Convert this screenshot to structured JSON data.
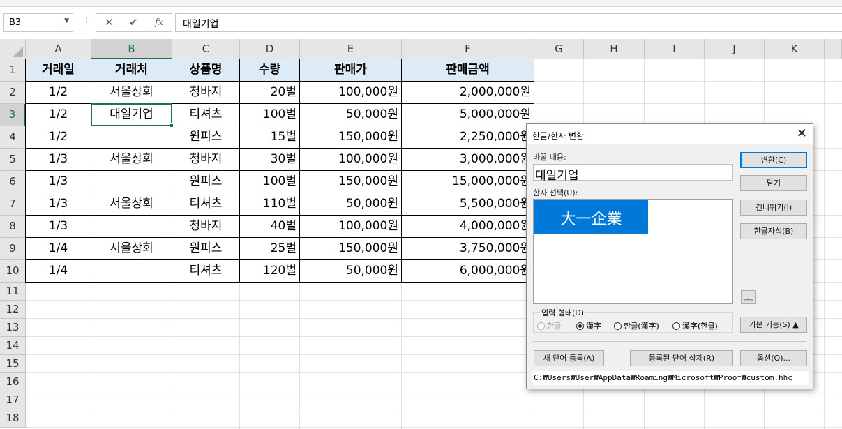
{
  "formula_bar": {
    "name_box": "B3",
    "cancel_icon": "✕",
    "enter_icon": "✔",
    "fx_icon": "fx",
    "content": "대일기업"
  },
  "grid": {
    "columns": [
      "A",
      "B",
      "C",
      "D",
      "E",
      "F",
      "G",
      "H",
      "I",
      "J",
      "K"
    ],
    "selected_column": "B",
    "rows": [
      "1",
      "2",
      "3",
      "4",
      "5",
      "6",
      "7",
      "8",
      "9",
      "10",
      "11",
      "12",
      "13",
      "14",
      "15",
      "16",
      "17",
      "18"
    ],
    "selected_row": "3",
    "table_headers": [
      "거래일",
      "거래처",
      "상품명",
      "수량",
      "판매가",
      "판매금액"
    ],
    "table_rows": [
      [
        "1/2",
        "서울상회",
        "청바지",
        "20벌",
        "100,000원",
        "2,000,000원"
      ],
      [
        "1/2",
        "대일기업",
        "티셔츠",
        "100벌",
        "50,000원",
        "5,000,000원"
      ],
      [
        "1/2",
        "",
        "원피스",
        "15벌",
        "150,000원",
        "2,250,000원"
      ],
      [
        "1/3",
        "서울상회",
        "청바지",
        "30벌",
        "100,000원",
        "3,000,000원"
      ],
      [
        "1/3",
        "",
        "원피스",
        "100벌",
        "150,000원",
        "15,000,000원"
      ],
      [
        "1/3",
        "서울상회",
        "티셔츠",
        "110벌",
        "50,000원",
        "5,500,000원"
      ],
      [
        "1/3",
        "",
        "청바지",
        "40벌",
        "100,000원",
        "4,000,000원"
      ],
      [
        "1/4",
        "서울상회",
        "원피스",
        "25벌",
        "150,000원",
        "3,750,000원"
      ],
      [
        "1/4",
        "",
        "티셔츠",
        "120벌",
        "50,000원",
        "6,000,000원"
      ]
    ]
  },
  "dialog": {
    "title": "한글/한자 변환",
    "close_icon": "✕",
    "word_label": "바꿀 내용:",
    "word_value": "대일기업",
    "hanja_label": "한자 선택(U):",
    "hanja_options": [
      "大一企業"
    ],
    "buttons": {
      "convert": "변환(C)",
      "close": "닫기",
      "skip": "건너뛰기(I)",
      "hangul_dict": "한글자식(B)",
      "basic_mode": "기본 기능(S) ▲"
    },
    "dictionary_icon": "📖",
    "input_form_label": "입력 형태(D)",
    "input_forms": [
      "한글",
      "漢字",
      "한글(漢字)",
      "漢字(한글)"
    ],
    "input_form_selected": "漢字",
    "bottom_buttons": {
      "register": "새 단어 등록(A)",
      "delete_registered": "등록된 단어 삭제(R)",
      "options": "옵션(O)..."
    },
    "dictionary_path": "C:₩Users₩User₩AppData₩Roaming₩Microsoft₩Proof₩custom.hhc"
  },
  "colors": {
    "excel_green": "#217346",
    "header_fill": "#ddebf7",
    "selection_blue": "#0078d7"
  }
}
